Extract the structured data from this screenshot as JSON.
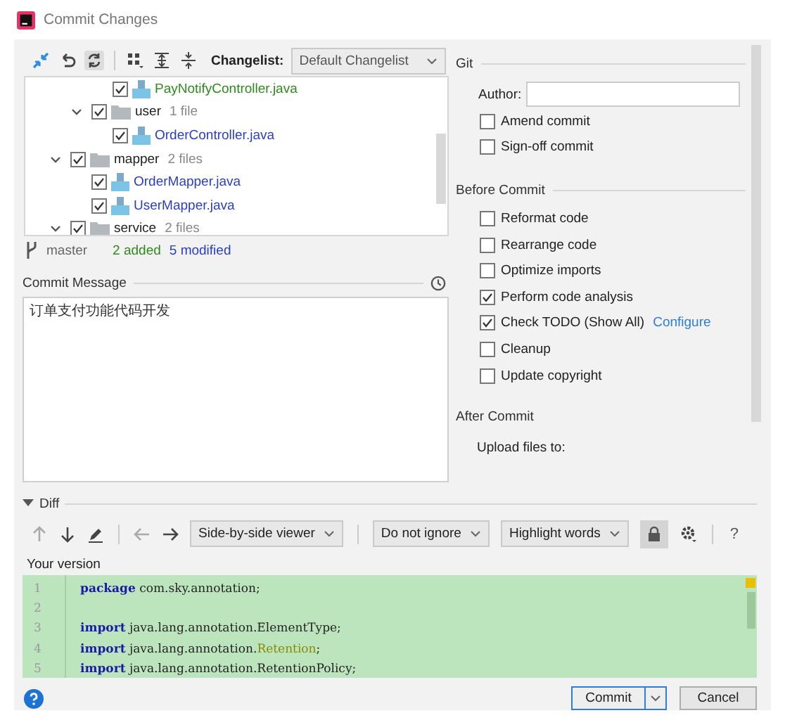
{
  "window": {
    "title": "Commit Changes"
  },
  "changes": {
    "changelist_label": "Changelist:",
    "changelist": "Default Changelist",
    "tree": [
      {
        "children": [
          {
            "children": [
              {
                "kind": "file",
                "name": "PayNotifyController.java",
                "color": "#2f8a1e",
                "checked": true
              }
            ]
          },
          {
            "kind": "folder",
            "name": "user",
            "count": "1 file",
            "checked": true,
            "expanded": true,
            "children": [
              {
                "kind": "file",
                "name": "OrderController.java",
                "color": "#2a3fbf",
                "checked": true
              }
            ]
          }
        ]
      },
      {
        "kind": "folder",
        "name": "mapper",
        "count": "2 files",
        "checked": true,
        "expanded": true,
        "children": [
          {
            "kind": "file",
            "name": "OrderMapper.java",
            "color": "#2a3fbf",
            "checked": true
          },
          {
            "kind": "file",
            "name": "UserMapper.java",
            "color": "#2a3fbf",
            "checked": true
          }
        ]
      },
      {
        "kind": "folder",
        "name": "service",
        "count": "2 files",
        "checked": true,
        "expanded": true
      }
    ],
    "branch": "master",
    "added": "2 added",
    "modified": "5 modified"
  },
  "commit_message": {
    "label": "Commit Message",
    "value": "订单支付功能代码开发"
  },
  "git": {
    "title": "Git",
    "author_label": "Author:",
    "options": [
      {
        "label": "Amend commit",
        "checked": false
      },
      {
        "label": "Sign-off commit",
        "checked": false
      }
    ]
  },
  "before_commit": {
    "title": "Before Commit",
    "options": [
      {
        "label": "Reformat code",
        "checked": false
      },
      {
        "label": "Rearrange code",
        "checked": false
      },
      {
        "label": "Optimize imports",
        "checked": false
      },
      {
        "label": "Perform code analysis",
        "checked": true
      },
      {
        "label": "Check TODO (Show All)",
        "checked": true,
        "link": "Configure"
      },
      {
        "label": "Cleanup",
        "checked": false
      },
      {
        "label": "Update copyright",
        "checked": false
      }
    ]
  },
  "after_commit": {
    "title": "After Commit",
    "upload_label": "Upload files to:"
  },
  "diff": {
    "title": "Diff",
    "expanded": true,
    "viewer": "Side-by-side viewer",
    "ignore": "Do not ignore",
    "highlight": "Highlight words",
    "help": "?",
    "version_label": "Your version",
    "lines": [
      {
        "number": "1",
        "tokens": [
          {
            "kind": "keyword",
            "text": "package"
          },
          {
            "kind": "plain",
            "text": " com.sky.annotation;"
          }
        ]
      },
      {
        "number": "2"
      },
      {
        "number": "3",
        "tokens": [
          {
            "kind": "keyword",
            "text": "import"
          },
          {
            "kind": "plain",
            "text": " java.lang.annotation.ElementType;"
          }
        ]
      },
      {
        "number": "4",
        "tokens": [
          {
            "kind": "keyword",
            "text": "import"
          },
          {
            "kind": "plain",
            "text": " java.lang.annotation."
          },
          {
            "kind": "type",
            "text": "Retention"
          },
          {
            "kind": "plain",
            "text": ";"
          }
        ]
      },
      {
        "number": "5",
        "tokens": [
          {
            "kind": "keyword",
            "text": "import"
          },
          {
            "kind": "plain",
            "text": " java.lang.annotation.RetentionPolicy;"
          }
        ]
      }
    ]
  },
  "buttons": [
    {
      "label": "Commit",
      "kind": "primary"
    },
    {
      "label": "Cancel",
      "kind": "plain"
    }
  ]
}
